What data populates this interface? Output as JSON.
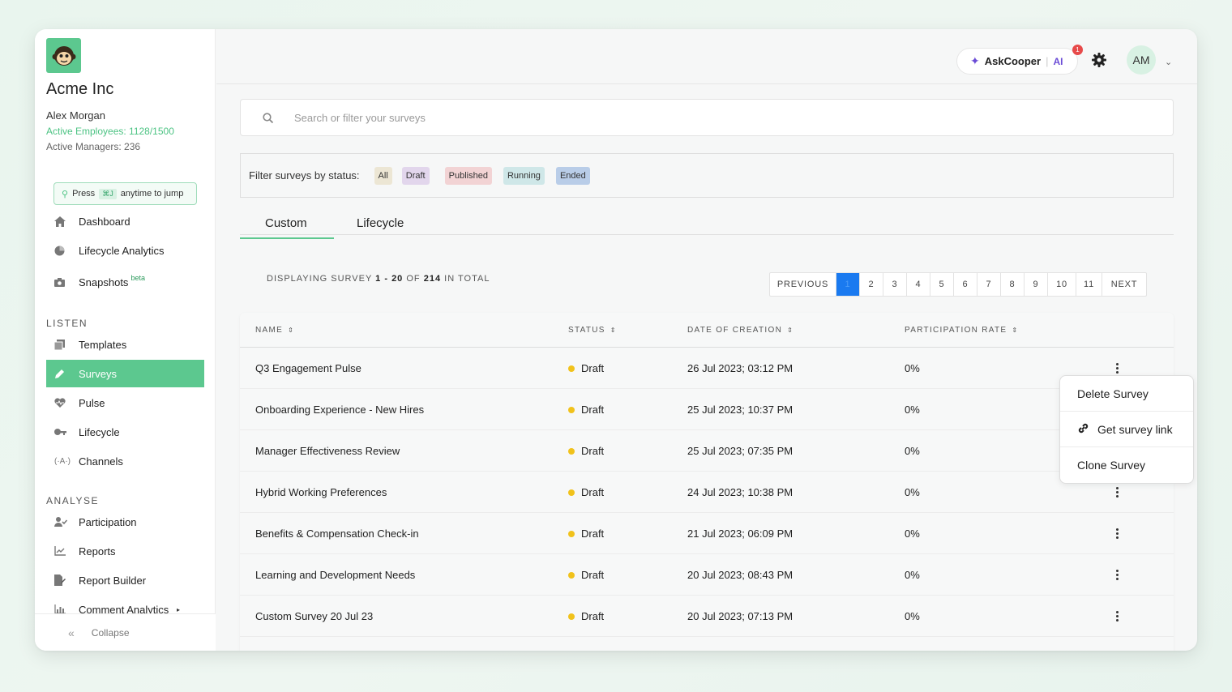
{
  "sidebar": {
    "company": "Acme Inc",
    "user": "Alex Morgan",
    "active_employees": "Active Employees: 1128/1500",
    "active_managers": "Active Managers: 236",
    "jump": {
      "press": "Press",
      "shortcut": "⌘J",
      "suffix": "anytime to jump"
    },
    "nav_top": [
      {
        "label": "Dashboard",
        "icon": "home-icon"
      },
      {
        "label": "Lifecycle Analytics",
        "icon": "pie-chart-icon"
      },
      {
        "label": "Snapshots",
        "icon": "camera-icon",
        "badge": "beta"
      }
    ],
    "listen_label": "LISTEN",
    "listen": [
      {
        "label": "Templates",
        "icon": "copy-icon"
      },
      {
        "label": "Surveys",
        "icon": "pen-icon",
        "active": true
      },
      {
        "label": "Pulse",
        "icon": "heart-pulse-icon"
      },
      {
        "label": "Lifecycle",
        "icon": "key-icon"
      },
      {
        "label": "Channels",
        "icon": "broadcast-icon"
      }
    ],
    "analyse_label": "ANALYSE",
    "analyse": [
      {
        "label": "Participation",
        "icon": "user-check-icon"
      },
      {
        "label": "Reports",
        "icon": "line-chart-icon"
      },
      {
        "label": "Report Builder",
        "icon": "file-edit-icon"
      },
      {
        "label": "Comment Analytics",
        "icon": "bar-chart-icon"
      }
    ],
    "collapse": "Collapse"
  },
  "header": {
    "ask_label": "AskCooper",
    "ask_ai": "AI",
    "notification_count": "1",
    "avatar": "AM"
  },
  "search": {
    "placeholder": "Search or filter your surveys"
  },
  "filter": {
    "label": "Filter surveys by status:",
    "chips": [
      {
        "label": "All",
        "color": "#ece6d4"
      },
      {
        "label": "Draft",
        "color": "#e2d6ec"
      },
      {
        "label": "Published",
        "color": "#f2d3d4"
      },
      {
        "label": "Running",
        "color": "#cfe7e8"
      },
      {
        "label": "Ended",
        "color": "#b9cde8"
      }
    ]
  },
  "tabs": [
    "Custom",
    "Lifecycle"
  ],
  "display": {
    "prefix": "DISPLAYING SURVEY",
    "range": "1 - 20",
    "of": "OF",
    "total": "214",
    "suffix": "IN TOTAL"
  },
  "pager": {
    "previous": "PREVIOUS",
    "pages": [
      "1",
      "2",
      "3",
      "4",
      "5",
      "6",
      "7",
      "8",
      "9",
      "10",
      "11"
    ],
    "current": "1",
    "next": "NEXT"
  },
  "table": {
    "columns": [
      "NAME",
      "STATUS",
      "DATE OF CREATION",
      "PARTICIPATION RATE"
    ],
    "rows": [
      {
        "name": "Q3 Engagement Pulse",
        "status": "Draft",
        "date": "26 Jul 2023; 03:12 PM",
        "rate": "0%"
      },
      {
        "name": "Onboarding Experience - New Hires",
        "status": "Draft",
        "date": "25 Jul 2023; 10:37 PM",
        "rate": "0%"
      },
      {
        "name": "Manager Effectiveness Review",
        "status": "Draft",
        "date": "25 Jul 2023; 07:35 PM",
        "rate": "0%"
      },
      {
        "name": "Hybrid Working Preferences",
        "status": "Draft",
        "date": "24 Jul 2023; 10:38 PM",
        "rate": "0%"
      },
      {
        "name": "Benefits & Compensation Check-in",
        "status": "Draft",
        "date": "21 Jul 2023; 06:09 PM",
        "rate": "0%"
      },
      {
        "name": "Learning and Development Needs",
        "status": "Draft",
        "date": "20 Jul 2023; 08:43 PM",
        "rate": "0%"
      },
      {
        "name": "Custom Survey 20 Jul 23",
        "status": "Draft",
        "date": "20 Jul 2023; 07:13 PM",
        "rate": "0%"
      }
    ]
  },
  "menu": {
    "items": [
      "Delete Survey",
      "Get survey link",
      "Clone Survey"
    ]
  },
  "colors": {
    "accent": "#5cc88f",
    "draft": "#f1c21b",
    "pager_current": "#1a7af0",
    "ask_purple": "#6a4bd6"
  }
}
